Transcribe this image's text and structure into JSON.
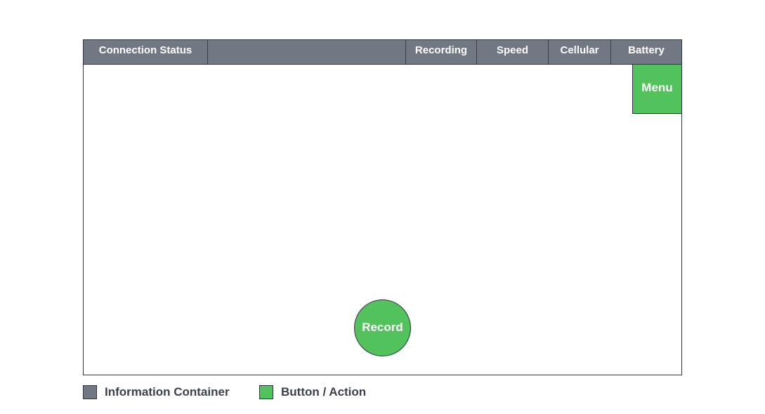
{
  "topbar": {
    "connection_status": "Connection Status",
    "empty_slot": "",
    "recording": "Recording",
    "speed": "Speed",
    "cellular": "Cellular",
    "battery": "Battery"
  },
  "buttons": {
    "menu": "Menu",
    "record": "Record"
  },
  "legend": {
    "information_container": "Information Container",
    "button_action": "Button / Action"
  },
  "colors": {
    "information_container": "#717783",
    "button_action": "#52c35c",
    "border": "#2f3440"
  }
}
